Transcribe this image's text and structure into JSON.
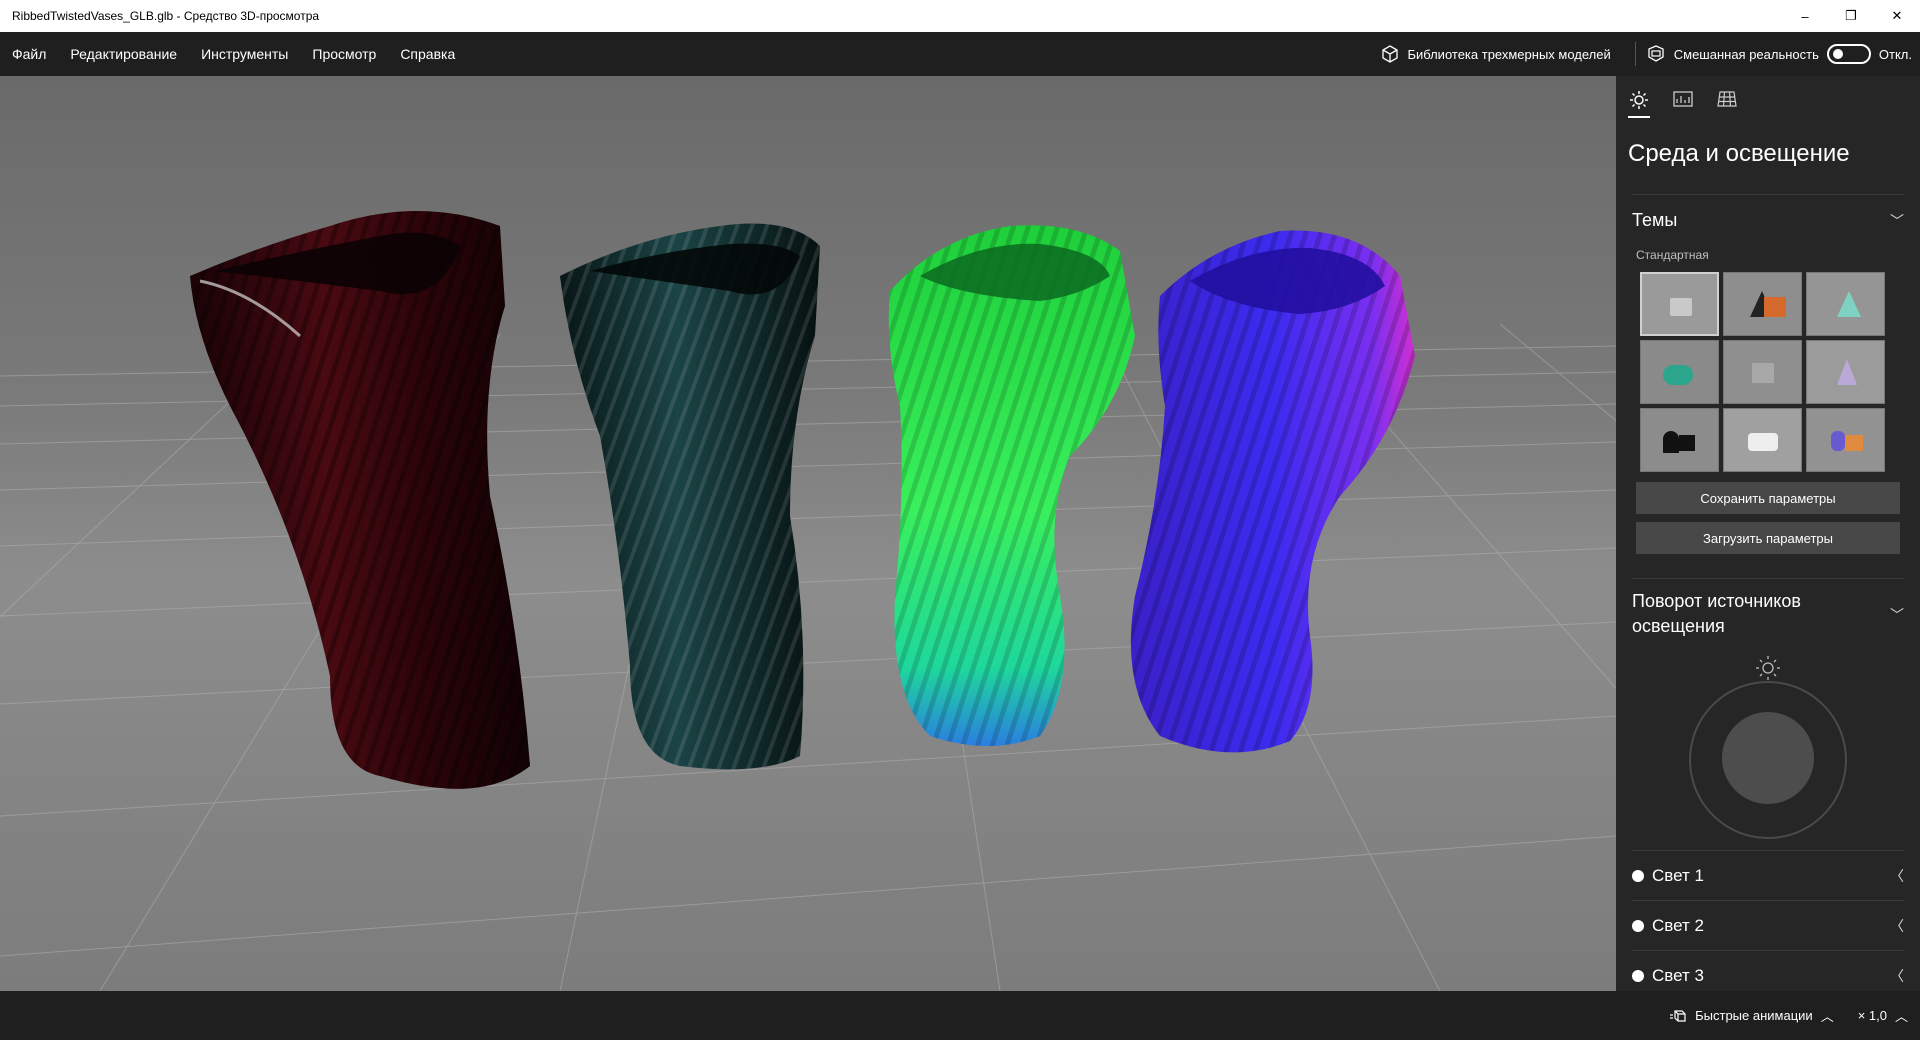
{
  "window": {
    "title": "RibbedTwistedVases_GLB.glb - Средство 3D-просмотра",
    "minimize": "–",
    "restore": "❐",
    "close": "✕"
  },
  "menu": {
    "items": [
      "Файл",
      "Редактирование",
      "Инструменты",
      "Просмотр",
      "Справка"
    ],
    "library_label": "Библиотека трехмерных моделей",
    "mixed_reality_label": "Смешанная реальность",
    "mixed_reality_state": "Откл."
  },
  "panel": {
    "title": "Среда и освещение",
    "themes_label": "Темы",
    "themes_sub": "Стандартная",
    "save_label": "Сохранить параметры",
    "load_label": "Загрузить параметры",
    "rotation_label": "Поворот источников освещения",
    "lights": [
      "Свет 1",
      "Свет 2",
      "Свет 3"
    ]
  },
  "status": {
    "animations_label": "Быстрые анимации",
    "speed_label": "× 1,0"
  },
  "icons": {
    "tab1": "sun-icon",
    "tab2": "image-stats-icon",
    "tab3": "grid-icon"
  },
  "colors": {
    "vase1": "#3a0a0f",
    "vase2": "#0f2e30",
    "vase3": "#22d44a",
    "vase4": "#4a2fe0"
  }
}
